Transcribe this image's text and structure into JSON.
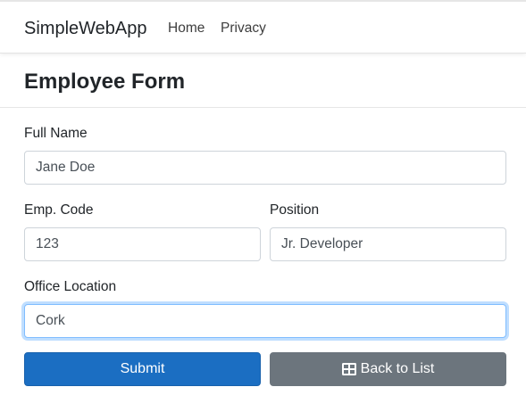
{
  "navbar": {
    "brand": "SimpleWebApp",
    "links": [
      "Home",
      "Privacy"
    ]
  },
  "page": {
    "title": "Employee Form"
  },
  "form": {
    "full_name": {
      "label": "Full Name",
      "value": "Jane Doe"
    },
    "emp_code": {
      "label": "Emp. Code",
      "value": "123"
    },
    "position": {
      "label": "Position",
      "value": "Jr. Developer"
    },
    "office_location": {
      "label": "Office Location",
      "value": "Cork"
    },
    "submit_label": "Submit",
    "back_label": "Back to List"
  },
  "colors": {
    "primary": "#1b6ec2",
    "secondary": "#6c757d",
    "focus": "#80bdff"
  },
  "icons": {
    "back": "table-icon"
  }
}
